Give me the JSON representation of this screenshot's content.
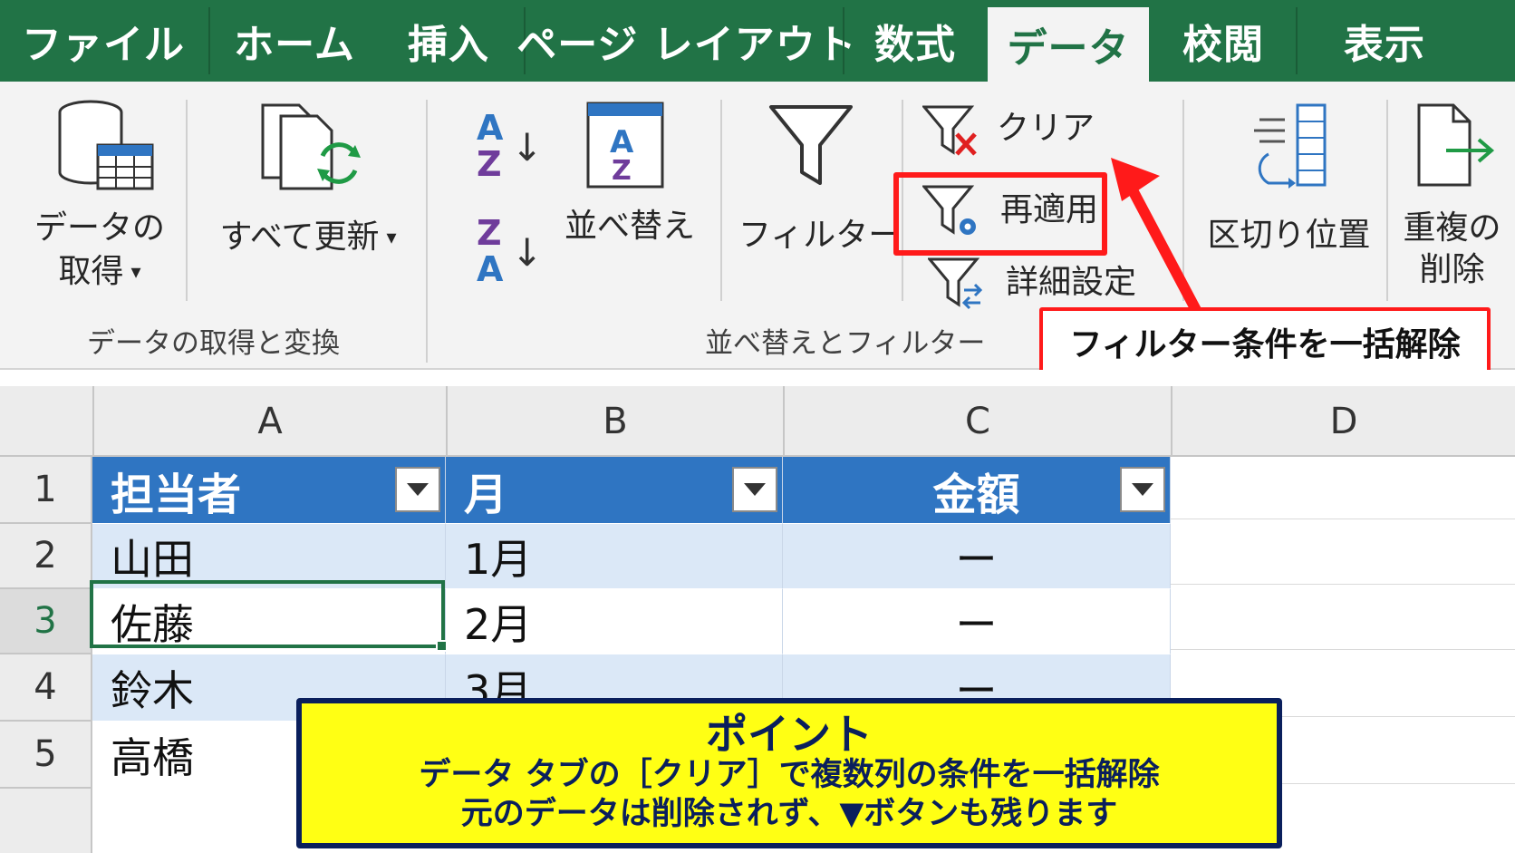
{
  "tabs": [
    {
      "label": "ファイル",
      "active": false
    },
    {
      "label": "ホーム",
      "active": false
    },
    {
      "label": "挿入",
      "active": false
    },
    {
      "label": "ページ レイアウト",
      "active": false
    },
    {
      "label": "数式",
      "active": false
    },
    {
      "label": "データ",
      "active": true
    },
    {
      "label": "校閲",
      "active": false
    },
    {
      "label": "表示",
      "active": false
    }
  ],
  "ribbon": {
    "get_data_label_1": "データの",
    "get_data_label_2": "取得",
    "refresh_all_label": "すべて更新",
    "sort_label": "並べ替え",
    "filter_label": "フィルター",
    "clear_label": "クリア",
    "reapply_label": "再適用",
    "advanced_label": "詳細設定",
    "text_to_columns_label": "区切り位置",
    "remove_duplicates_label_1": "重複の",
    "remove_duplicates_label_2": "削除",
    "group_get_transform": "データの取得と変換",
    "group_sort_filter": "並べ替えとフィルター",
    "dropdown_glyph": "▾",
    "sort_az_glyph_top": "A",
    "sort_az_glyph_bottom": "Z",
    "sort_za_glyph_top": "Z",
    "sort_za_glyph_bottom": "A",
    "arrow_down_glyph": "↓"
  },
  "callout": {
    "text": "フィルター条件を一括解除",
    "color": "#ff1a1a"
  },
  "sheet": {
    "columns": [
      "A",
      "B",
      "C",
      "D"
    ],
    "rows": [
      "1",
      "2",
      "3",
      "4",
      "5"
    ],
    "active_row": "3",
    "header": [
      "担当者",
      "月",
      "金額"
    ],
    "data": [
      {
        "name": "山田",
        "month": "1月",
        "amount": "ー"
      },
      {
        "name": "佐藤",
        "month": "2月",
        "amount": "ー"
      },
      {
        "name": "鈴木",
        "month": "3月",
        "amount": "ー"
      },
      {
        "name": "高橋",
        "month": "",
        "amount": ""
      }
    ],
    "header_color": "#2f75c2",
    "band_color": "#dbe8f7",
    "selection_color": "#217346"
  },
  "point": {
    "title": "ポイント",
    "line1": "データ タブの［クリア］で複数列の条件を一括解除",
    "line2": "元のデータは削除されず、▼ボタンも残ります"
  },
  "colors": {
    "excel_green": "#217346",
    "point_bg": "#ffff14",
    "point_border": "#0a1f5c"
  }
}
